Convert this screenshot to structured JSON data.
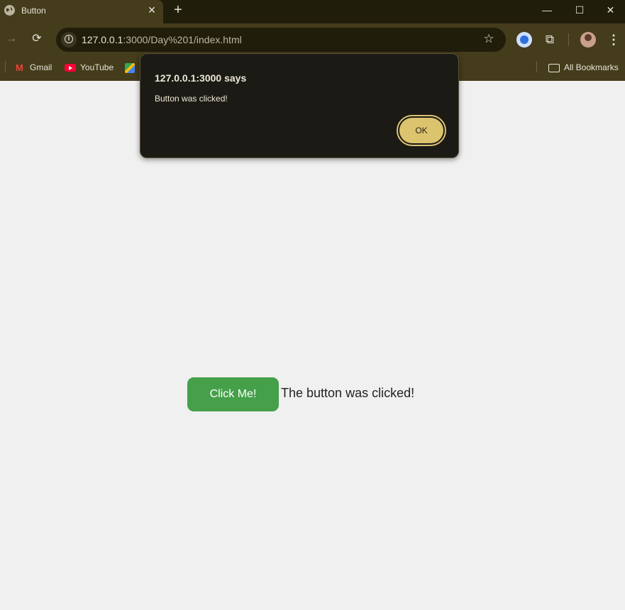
{
  "tab": {
    "title": "Button",
    "close": "✕",
    "new_tab": "+"
  },
  "window": {
    "minimize": "—",
    "maximize": "☐",
    "close": "✕"
  },
  "toolbar": {
    "url_host": "127.0.0.1",
    "url_rest": ":3000/Day%201/index.html"
  },
  "bookmarks": {
    "items": [
      {
        "label": "Gmail",
        "icon": "gmail-icon"
      },
      {
        "label": "YouTube",
        "icon": "youtube-icon"
      },
      {
        "label": "",
        "icon": "maps-icon"
      }
    ],
    "all_bookmarks": "All Bookmarks"
  },
  "dialog": {
    "title": "127.0.0.1:3000 says",
    "message": "Button was clicked!",
    "ok_label": "OK"
  },
  "page": {
    "button_label": "Click Me!",
    "result_text": "The button was clicked!"
  },
  "colors": {
    "chrome_dark": "#211d0b",
    "chrome_mid": "#453c1c",
    "button_green": "#45a049",
    "ok_gold": "#dcc36e"
  }
}
